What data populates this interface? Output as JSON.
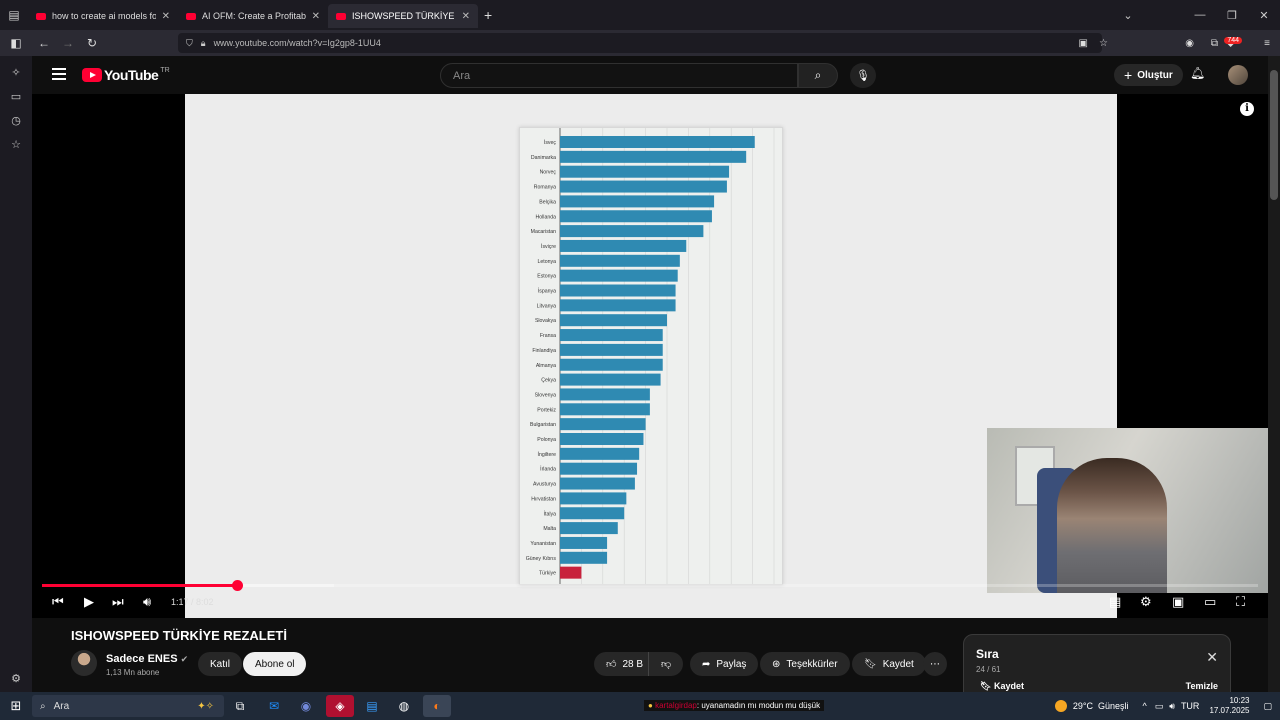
{
  "browser": {
    "tabs": [
      {
        "title": "how to create ai models for onl",
        "active": false
      },
      {
        "title": "AI OFM: Create a Profitable AI I",
        "active": false
      },
      {
        "title": "ISHOWSPEED TÜRKİYE REZALE",
        "active": true
      }
    ],
    "new_tab_icon": "plus-icon",
    "url": "www.youtube.com/watch?v=Ig2gp8-1UU4",
    "extension_badge": "744"
  },
  "youtube": {
    "logo_text": "YouTube",
    "country_code": "TR",
    "search_placeholder": "Ara",
    "create_label": "Oluştur"
  },
  "player": {
    "time_current": "1:17",
    "time_separator": " / ",
    "time_total": "8:02",
    "progress_fraction": 0.16,
    "buffered_fraction": 0.24,
    "info_label": "i"
  },
  "video": {
    "title": "ISHOWSPEED TÜRKİYE REZALETİ",
    "channel": "Sadece ENES",
    "verified_icon": "verified-check-icon",
    "subscribers": "1,13 Mn abone",
    "join_label": "Katıl",
    "subscribe_label": "Abone ol",
    "likes": "28 B",
    "share_label": "Paylaş",
    "thanks_label": "Teşekkürler",
    "save_label": "Kaydet",
    "more_icon": "more-horizontal-icon"
  },
  "queue": {
    "title": "Sıra",
    "count": "24 / 61",
    "save_label": "Kaydet",
    "clear_label": "Temizle"
  },
  "taskbar": {
    "search_placeholder": "Ara",
    "notification_user": "kartalgirdap",
    "notification_text": ": uyanamadın mı modun mu düşük",
    "weather": "29°C",
    "weather_desc": "Güneşli",
    "lang": "TUR",
    "time": "10:23",
    "date": "17.07.2025"
  },
  "chart_data": {
    "type": "bar",
    "orientation": "horizontal",
    "categories": [
      "İsveç",
      "Danimarka",
      "Norveç",
      "Romanya",
      "Belçika",
      "Hollanda",
      "Macaristan",
      "İsviçre",
      "Letonya",
      "Estonya",
      "İspanya",
      "Litvanya",
      "Slovakya",
      "Fransa",
      "Finlandiya",
      "Almanya",
      "Çekya",
      "Slovenya",
      "Portekiz",
      "Bulgaristan",
      "Polonya",
      "İngiltere",
      "İrlanda",
      "Avusturya",
      "Hırvatistan",
      "İtalya",
      "Malta",
      "Yunanistan",
      "Güney Kıbrıs",
      "Türkiye"
    ],
    "values": [
      91,
      87,
      79,
      78,
      72,
      71,
      67,
      59,
      56,
      55,
      54,
      54,
      50,
      48,
      48,
      48,
      47,
      42,
      42,
      40,
      39,
      37,
      36,
      35,
      31,
      30,
      27,
      22,
      22,
      10
    ],
    "highlight_category": "Türkiye",
    "bar_color": "#2f8ab2",
    "highlight_color": "#c8213c",
    "xlim": [
      0,
      100
    ],
    "grid": true
  }
}
